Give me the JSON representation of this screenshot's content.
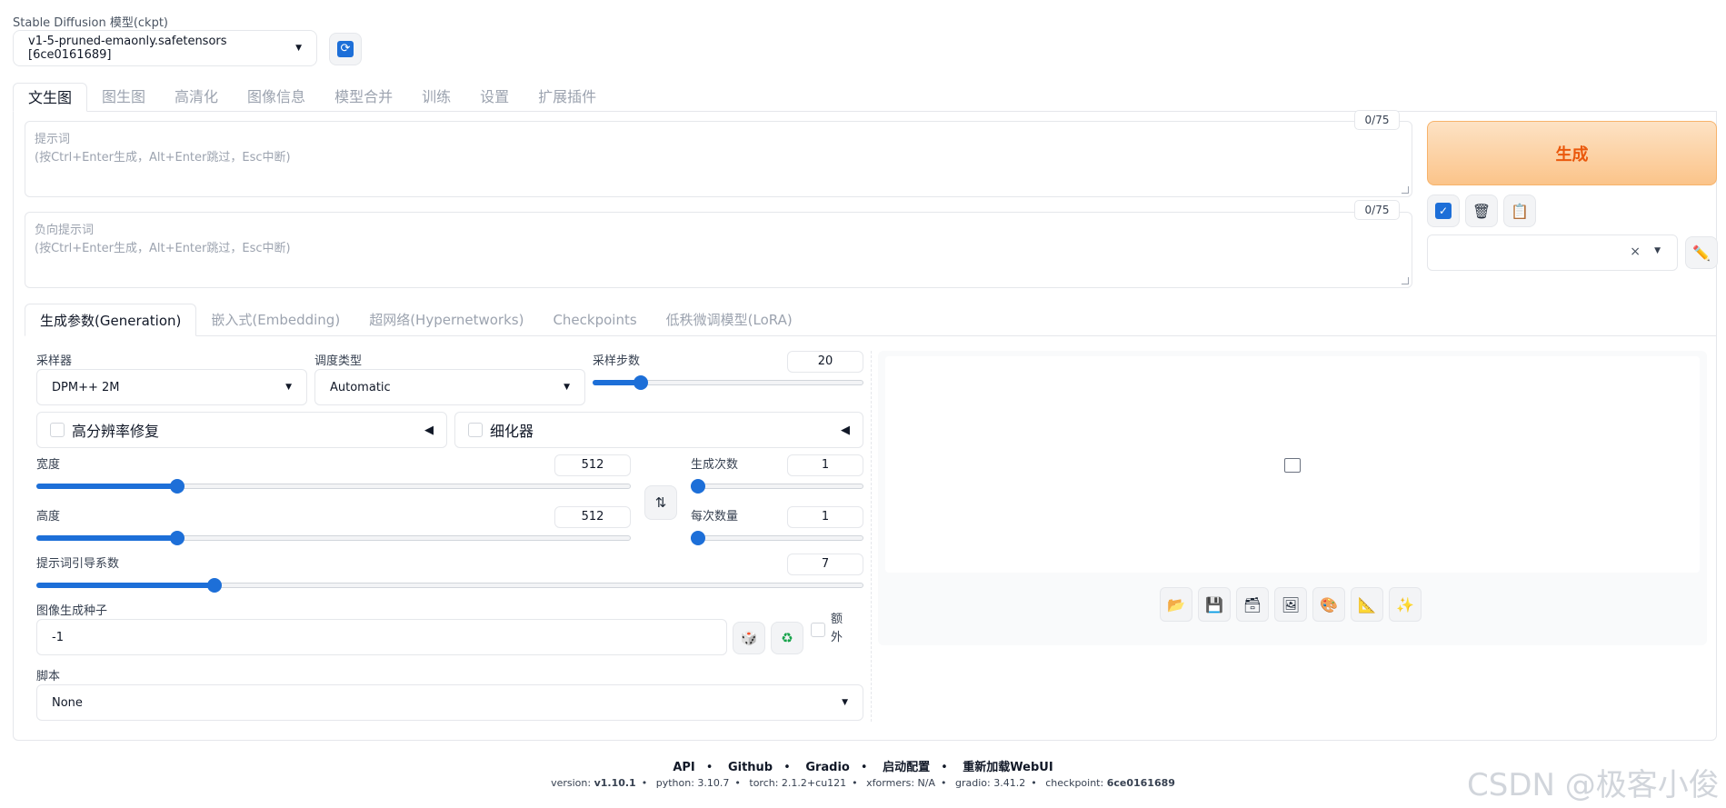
{
  "checkpoint": {
    "label": "Stable Diffusion 模型(ckpt)",
    "selected": "v1-5-pruned-emaonly.safetensors [6ce0161689]"
  },
  "main_tabs": [
    "文生图",
    "图生图",
    "高清化",
    "图像信息",
    "模型合并",
    "训练",
    "设置",
    "扩展插件"
  ],
  "prompt": {
    "placeholder_line1": "提示词",
    "placeholder_line2": "(按Ctrl+Enter生成，Alt+Enter跳过，Esc中断)",
    "counter": "0/75"
  },
  "negative_prompt": {
    "placeholder_line1": "负向提示词",
    "placeholder_line2": "(按Ctrl+Enter生成，Alt+Enter跳过，Esc中断)",
    "counter": "0/75"
  },
  "generate_label": "生成",
  "sub_tabs": [
    "生成参数(Generation)",
    "嵌入式(Embedding)",
    "超网络(Hypernetworks)",
    "Checkpoints",
    "低秩微调模型(LoRA)"
  ],
  "sampler": {
    "label": "采样器",
    "value": "DPM++ 2M"
  },
  "schedule": {
    "label": "调度类型",
    "value": "Automatic"
  },
  "steps": {
    "label": "采样步数",
    "value": "20",
    "fraction": 0.16
  },
  "hires_fix": {
    "label": "高分辨率修复"
  },
  "refiner": {
    "label": "细化器"
  },
  "width": {
    "label": "宽度",
    "value": "512",
    "fraction": 0.23
  },
  "height": {
    "label": "高度",
    "value": "512",
    "fraction": 0.23
  },
  "batch_count": {
    "label": "生成次数",
    "value": "1",
    "fraction": 0.0
  },
  "batch_size": {
    "label": "每次数量",
    "value": "1",
    "fraction": 0.0
  },
  "cfg_scale": {
    "label": "提示词引导系数",
    "value": "7",
    "fraction": 0.21
  },
  "seed": {
    "label": "图像生成种子",
    "value": "-1",
    "extra_line1": "额",
    "extra_line2": "外"
  },
  "script": {
    "label": "脚本",
    "value": "None"
  },
  "footer": {
    "links": [
      "API",
      "Github",
      "Gradio",
      "启动配置",
      "重新加载WebUI"
    ],
    "version_label": "version:",
    "version": "v1.10.1",
    "python": "python: 3.10.7",
    "torch": "torch: 2.1.2+cu121",
    "xformers": "xformers: N/A",
    "gradio": "gradio: 3.41.2",
    "checkpoint_label": "checkpoint:",
    "checkpoint": "6ce0161689"
  },
  "watermark": "CSDN @极客小俊",
  "colors": {
    "accent": "#1d6fd8",
    "generate_text": "#ea580c",
    "generate_bg": "#fbc48a"
  }
}
